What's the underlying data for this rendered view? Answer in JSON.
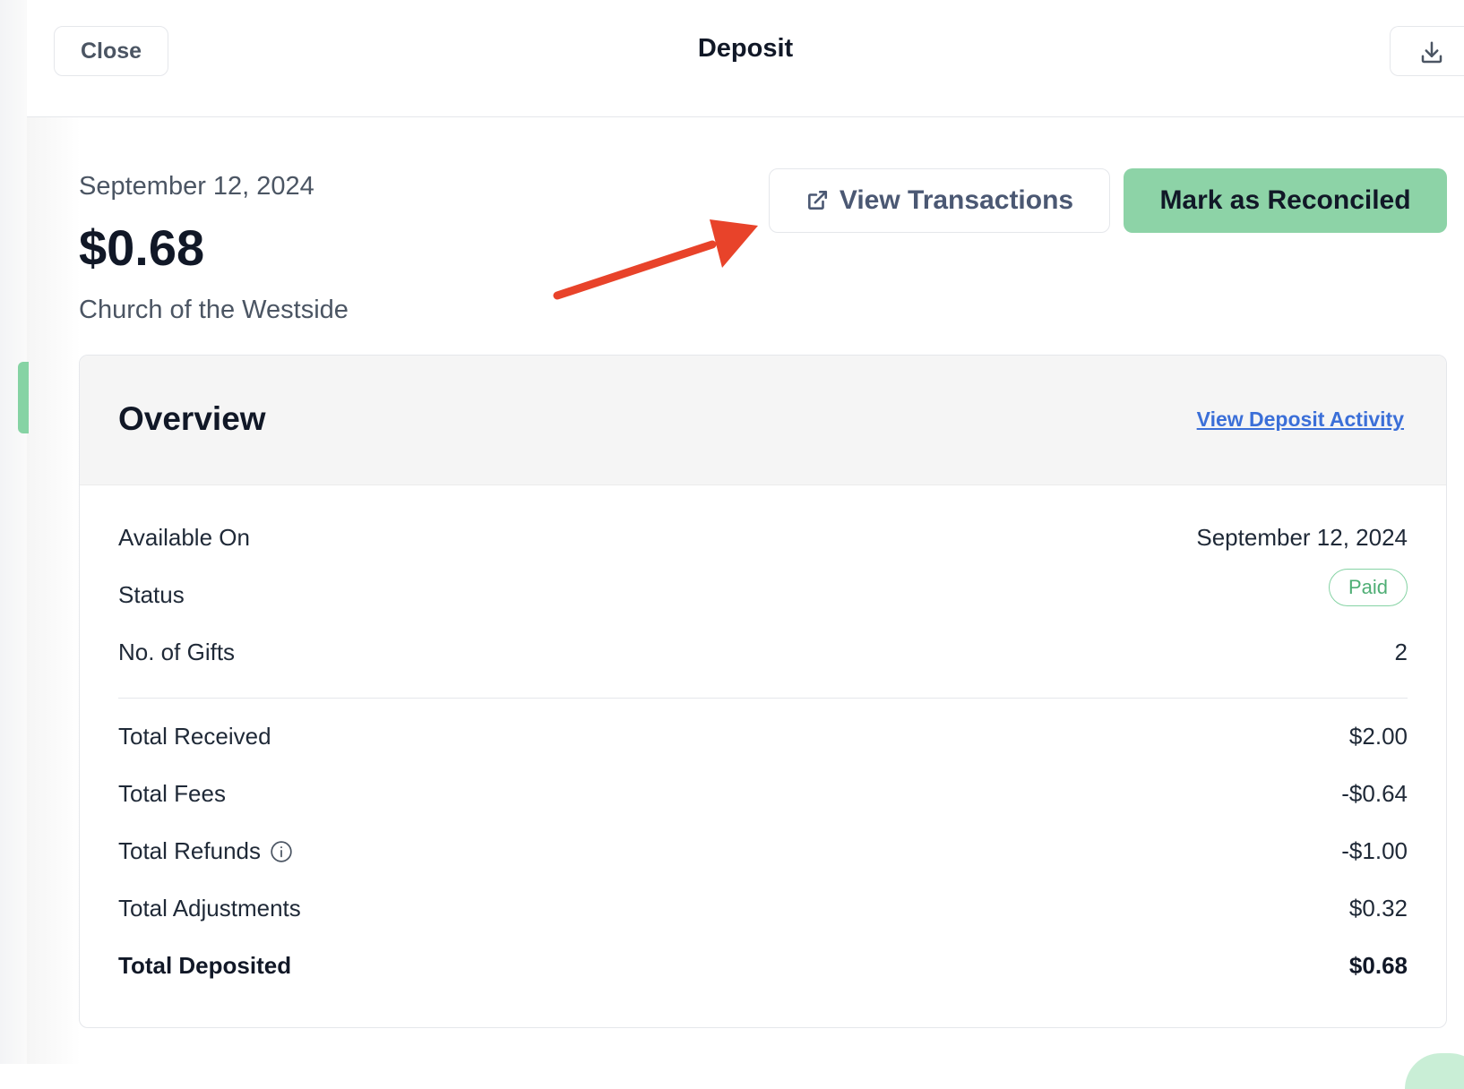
{
  "header": {
    "close_label": "Close",
    "title": "Deposit",
    "download_icon": "download-icon"
  },
  "deposit": {
    "date": "September 12, 2024",
    "amount": "$0.68",
    "organization": "Church of the Westside"
  },
  "actions": {
    "view_transactions_label": "View Transactions",
    "view_transactions_icon": "external-link-icon",
    "reconcile_label": "Mark as Reconciled"
  },
  "overview": {
    "title": "Overview",
    "activity_link": "View Deposit Activity",
    "available_on_label": "Available On",
    "available_on_value": "September 12, 2024",
    "status_label": "Status",
    "status_value": "Paid",
    "gifts_label": "No. of Gifts",
    "gifts_value": "2",
    "total_received_label": "Total Received",
    "total_received_value": "$2.00",
    "total_fees_label": "Total Fees",
    "total_fees_value": "-$0.64",
    "total_refunds_label": "Total Refunds",
    "total_refunds_value": "-$1.00",
    "total_adjustments_label": "Total Adjustments",
    "total_adjustments_value": "$0.32",
    "total_deposited_label": "Total Deposited",
    "total_deposited_value": "$0.68"
  },
  "colors": {
    "accent_green": "#8dd3a7",
    "link_blue": "#3b6fd8",
    "annotation_red": "#e8432a"
  }
}
